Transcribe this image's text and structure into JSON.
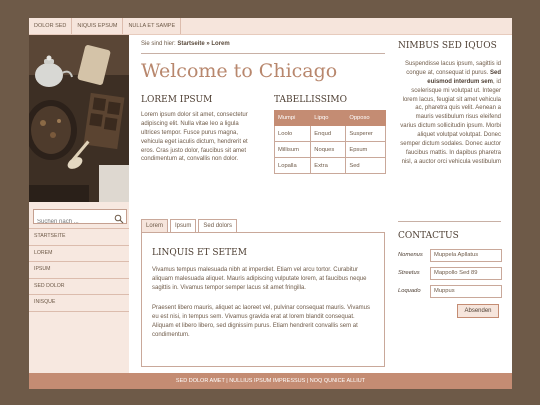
{
  "topnav": [
    "DOLOR SED",
    "NIQUIS EPSUM",
    "NULLA ET SAMPE"
  ],
  "search": {
    "placeholder": "Suchen nach ..."
  },
  "sidenav": [
    "STARTSEITE",
    "LOREM",
    "IPSUM",
    "SED DOLOR",
    "INISQUE"
  ],
  "breadcrumb": {
    "prefix": "Sie sind hier:",
    "trail": "Startseite » Lorem"
  },
  "page_title": "Welcome to Chicago",
  "lorem": {
    "heading": "LOREM IPSUM",
    "text": "Lorem ipsum dolor sit amet, consectetur adipiscing elit. Nulla vitae leo a ligula ultrices tempor. Fusce purus magna, vehicula eget iaculis dictum, hendrerit et eros. Cras justo dolor, faucibus sit amet condimentum at, convallis non dolor."
  },
  "tabellissimo": {
    "heading": "TABELLISSIMO",
    "columns": [
      "Mumpi",
      "Lipqo",
      "Opposo"
    ],
    "rows": [
      [
        "Loolo",
        "Enqud",
        "Susperer"
      ],
      [
        "Millisum",
        "Noques",
        "Epsum"
      ],
      [
        "Lopalla",
        "Extra",
        "Sed"
      ]
    ]
  },
  "tabs": [
    "Lorem",
    "Ipsum",
    "Sed dolors"
  ],
  "tabpanel": {
    "heading": "LINQUIS ET SETEM",
    "p1": "Vivamus tempus malesuada nibh at imperdiet. Etiam vel arcu tortor. Curabitur aliquam malesuada aliquet. Mauris adipiscing vulputate lorem, at faucibus neque sagittis in. Vivamus tempor semper lacus sit amet fringilla.",
    "p2": "Praesent libero mauris, aliquet ac laoreet vel, pulvinar consequat mauris. Vivamus eu est nisi, in tempus sem. Vivamus gravida erat at lorem blandit consequat. Aliquam et libero libero, sed dignissim purus. Etiam hendrerit convallis sem at condimentum."
  },
  "nimbus": {
    "heading": "NIMBUS SED IQUOS",
    "text_before": "Suspendisse lacus ipsum, sagittis id congue at, consequat id purus.",
    "bold": "Sed euismod interdum sem",
    "text_after": ", id scelerisque mi volutpat ut. Integer lorem lacus, feugiat sit amet vehicula ac, pharetra quis velit. Aenean a mauris vestibulum risus eleifend varius dictum sollicitudin ipsum. Morbi aliquet volutpat volutpat. Donec semper dictum sodales. Donec auctor faucibus mattis. In dapibus pharetra nisl, a auctor orci vehicula vestibulum"
  },
  "contactus": {
    "heading": "CONTACTUS",
    "fields": [
      {
        "label": "Nomenus",
        "value": "Muppela Apllatus"
      },
      {
        "label": "Streetus",
        "value": "Mappollo Sed 89"
      },
      {
        "label": "Loquado",
        "value": "Muppus"
      }
    ],
    "button": "Absenden"
  },
  "footer": "SED DOLOR AMET | NULLIUS IPSUM IMPRESSUS | NOQ QUNICE ALLIUT",
  "colors": {
    "accent": "#c48c73",
    "background": "#6e5a48",
    "nav_bg": "#f6e5dc",
    "title": "#b8876d"
  }
}
